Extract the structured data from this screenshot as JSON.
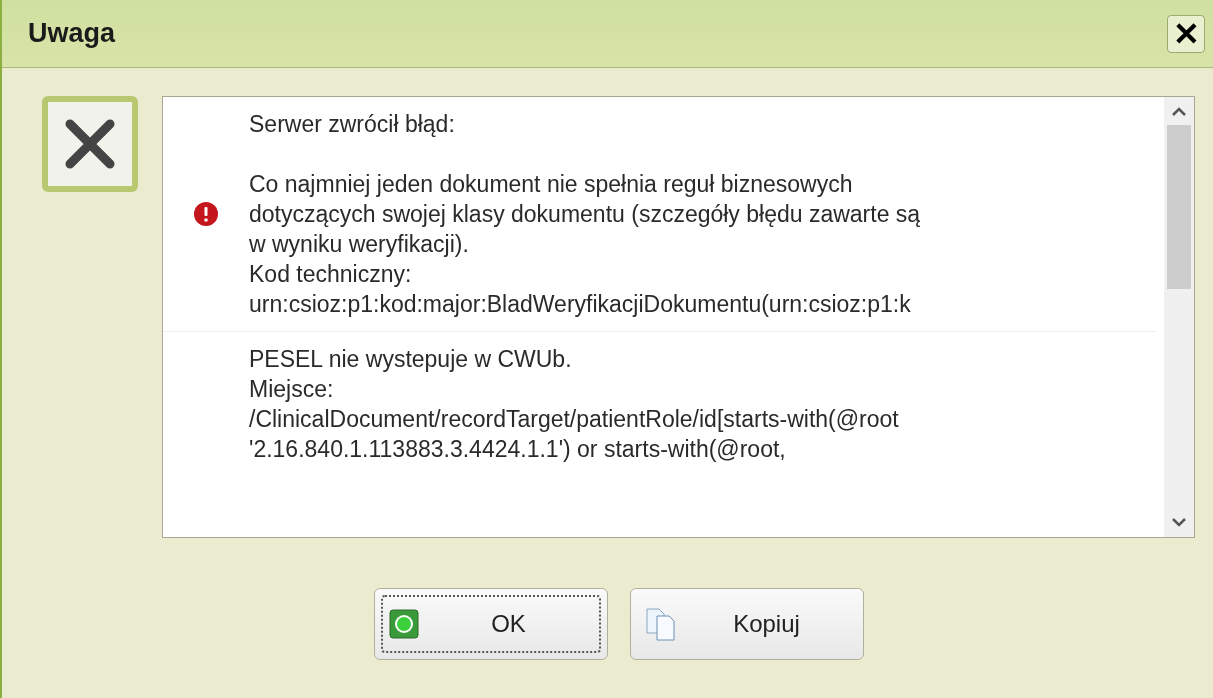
{
  "window": {
    "title": "Uwaga",
    "close": "✕"
  },
  "messages": [
    {
      "kind": "error",
      "paragraphs": [
        [
          "Serwer zwrócił błąd:"
        ],
        [
          "Co najmniej jeden dokument nie spełnia reguł biznesowych",
          "dotyczących swojej klasy dokumentu (szczegóły błędu zawarte są",
          "w wyniku weryfikacji).",
          "Kod techniczny:",
          "urn:csioz:p1:kod:major:BladWeryfikacjiDokumentu(urn:csioz:p1:k"
        ]
      ]
    },
    {
      "kind": "plain",
      "paragraphs": [
        [
          "PESEL nie wystepuje w CWUb.",
          "Miejsce:",
          "/ClinicalDocument/recordTarget/patientRole/id[starts-with(@root",
          "'2.16.840.1.113883.3.4424.1.1') or starts-with(@root,"
        ]
      ]
    }
  ],
  "buttons": [
    {
      "kind": "ok",
      "label": "OK",
      "focused": true
    },
    {
      "kind": "copy",
      "label": "Kopiuj",
      "focused": false
    }
  ]
}
